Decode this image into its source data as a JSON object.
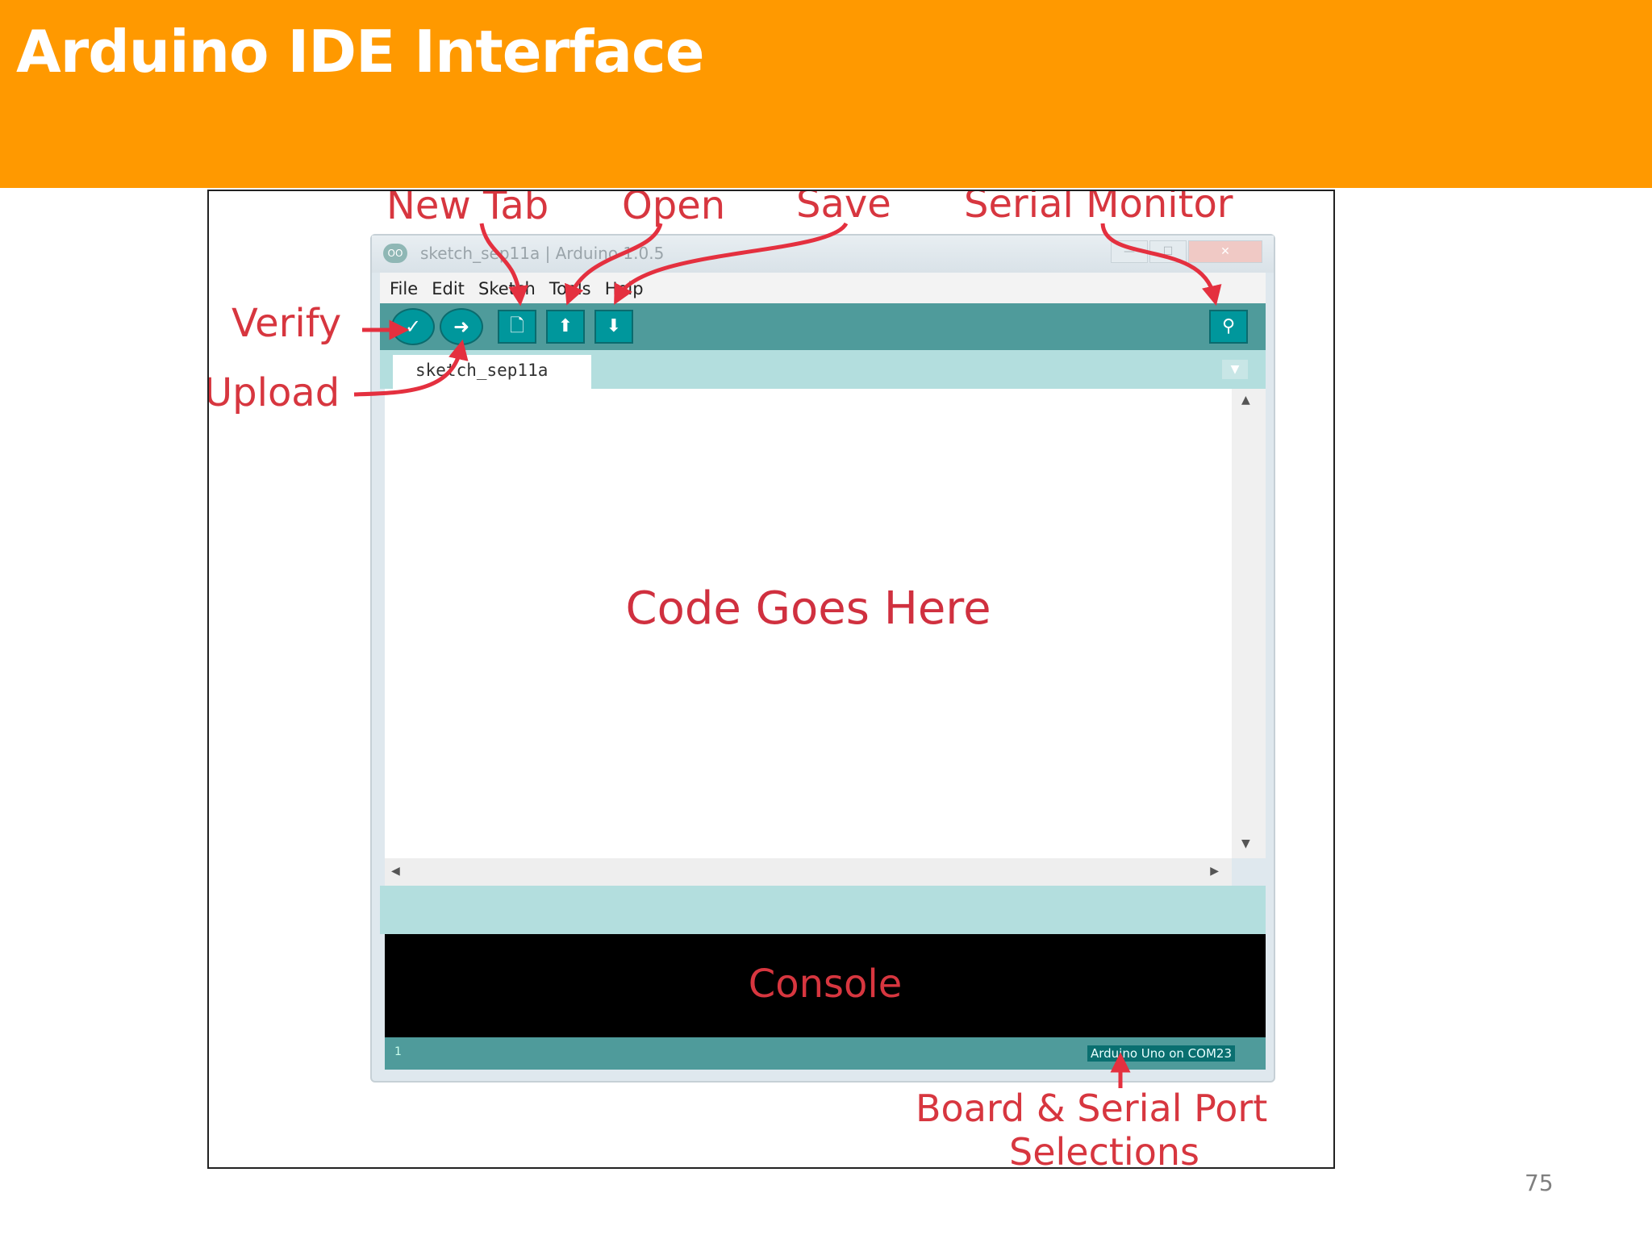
{
  "slide": {
    "title": "Arduino IDE Interface",
    "page_number": "75"
  },
  "colors": {
    "header_bar": "#FF9900",
    "annotation_red": "#d7363f",
    "toolbar_teal": "#4f9b9b",
    "button_teal": "#00979c"
  },
  "window": {
    "title": "sketch_sep11a | Arduino 1.0.5",
    "logo_text": "OO"
  },
  "menu": {
    "items": [
      "File",
      "Edit",
      "Sketch",
      "Tools",
      "Help"
    ]
  },
  "toolbar": {
    "buttons": [
      {
        "name": "verify",
        "icon": "checkmark-icon",
        "glyph": "✓"
      },
      {
        "name": "upload",
        "icon": "right-arrow-icon",
        "glyph": "➜"
      },
      {
        "name": "new",
        "icon": "new-file-icon",
        "glyph": "🗋"
      },
      {
        "name": "open",
        "icon": "up-arrow-icon",
        "glyph": "⬆"
      },
      {
        "name": "save",
        "icon": "down-arrow-icon",
        "glyph": "⬇"
      },
      {
        "name": "serial-monitor",
        "icon": "magnifier-icon",
        "glyph": "⚲"
      }
    ]
  },
  "editor": {
    "tab_label": "sketch_sep11a",
    "placeholder_note": "Code Goes Here"
  },
  "console": {
    "note": "Console"
  },
  "status": {
    "line_number": "1",
    "board_port": "Arduino Uno on COM23"
  },
  "annotations": {
    "new_tab": "New Tab",
    "open": "Open",
    "save": "Save",
    "serial_monitor": "Serial Monitor",
    "verify": "Verify",
    "upload": "Upload",
    "board_serial_line1": "Board & Serial Port",
    "board_serial_line2": "Selections"
  }
}
